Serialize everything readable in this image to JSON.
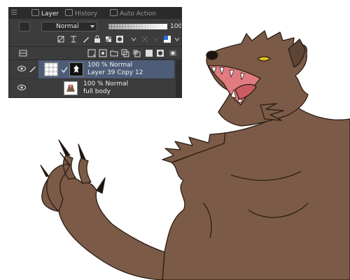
{
  "layer_panel": {
    "tabs": [
      {
        "label": "Layer",
        "icon": "layers-icon",
        "active": true
      },
      {
        "label": "History",
        "icon": "history-icon",
        "active": false
      },
      {
        "label": "Auto Action",
        "icon": "auto-action-icon",
        "active": false
      }
    ],
    "blend_mode": "Normal",
    "opacity": "100",
    "layers": [
      {
        "opacity_mode": "100 % Normal",
        "name": "Layer 39 Copy 12",
        "selected": true
      },
      {
        "opacity_mode": "100 % Normal",
        "name": "full body",
        "selected": false
      }
    ]
  },
  "colors": {
    "panel_bg": "#3c3c3c",
    "selection": "#4e5d77",
    "fur": "#7b5b47",
    "fur_shadow": "#5e4434",
    "mouth": "#e07b80",
    "eye": "#e3c11a"
  }
}
